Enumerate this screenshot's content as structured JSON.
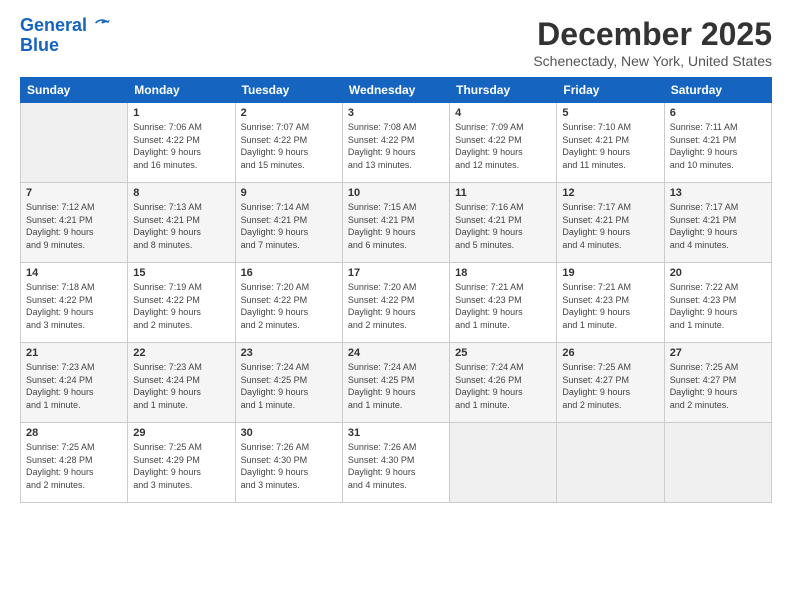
{
  "logo": {
    "line1": "General",
    "line2": "Blue"
  },
  "title": "December 2025",
  "location": "Schenectady, New York, United States",
  "days_header": [
    "Sunday",
    "Monday",
    "Tuesday",
    "Wednesday",
    "Thursday",
    "Friday",
    "Saturday"
  ],
  "weeks": [
    [
      {
        "day": "",
        "info": ""
      },
      {
        "day": "1",
        "info": "Sunrise: 7:06 AM\nSunset: 4:22 PM\nDaylight: 9 hours\nand 16 minutes."
      },
      {
        "day": "2",
        "info": "Sunrise: 7:07 AM\nSunset: 4:22 PM\nDaylight: 9 hours\nand 15 minutes."
      },
      {
        "day": "3",
        "info": "Sunrise: 7:08 AM\nSunset: 4:22 PM\nDaylight: 9 hours\nand 13 minutes."
      },
      {
        "day": "4",
        "info": "Sunrise: 7:09 AM\nSunset: 4:22 PM\nDaylight: 9 hours\nand 12 minutes."
      },
      {
        "day": "5",
        "info": "Sunrise: 7:10 AM\nSunset: 4:21 PM\nDaylight: 9 hours\nand 11 minutes."
      },
      {
        "day": "6",
        "info": "Sunrise: 7:11 AM\nSunset: 4:21 PM\nDaylight: 9 hours\nand 10 minutes."
      }
    ],
    [
      {
        "day": "7",
        "info": "Sunrise: 7:12 AM\nSunset: 4:21 PM\nDaylight: 9 hours\nand 9 minutes."
      },
      {
        "day": "8",
        "info": "Sunrise: 7:13 AM\nSunset: 4:21 PM\nDaylight: 9 hours\nand 8 minutes."
      },
      {
        "day": "9",
        "info": "Sunrise: 7:14 AM\nSunset: 4:21 PM\nDaylight: 9 hours\nand 7 minutes."
      },
      {
        "day": "10",
        "info": "Sunrise: 7:15 AM\nSunset: 4:21 PM\nDaylight: 9 hours\nand 6 minutes."
      },
      {
        "day": "11",
        "info": "Sunrise: 7:16 AM\nSunset: 4:21 PM\nDaylight: 9 hours\nand 5 minutes."
      },
      {
        "day": "12",
        "info": "Sunrise: 7:17 AM\nSunset: 4:21 PM\nDaylight: 9 hours\nand 4 minutes."
      },
      {
        "day": "13",
        "info": "Sunrise: 7:17 AM\nSunset: 4:21 PM\nDaylight: 9 hours\nand 4 minutes."
      }
    ],
    [
      {
        "day": "14",
        "info": "Sunrise: 7:18 AM\nSunset: 4:22 PM\nDaylight: 9 hours\nand 3 minutes."
      },
      {
        "day": "15",
        "info": "Sunrise: 7:19 AM\nSunset: 4:22 PM\nDaylight: 9 hours\nand 2 minutes."
      },
      {
        "day": "16",
        "info": "Sunrise: 7:20 AM\nSunset: 4:22 PM\nDaylight: 9 hours\nand 2 minutes."
      },
      {
        "day": "17",
        "info": "Sunrise: 7:20 AM\nSunset: 4:22 PM\nDaylight: 9 hours\nand 2 minutes."
      },
      {
        "day": "18",
        "info": "Sunrise: 7:21 AM\nSunset: 4:23 PM\nDaylight: 9 hours\nand 1 minute."
      },
      {
        "day": "19",
        "info": "Sunrise: 7:21 AM\nSunset: 4:23 PM\nDaylight: 9 hours\nand 1 minute."
      },
      {
        "day": "20",
        "info": "Sunrise: 7:22 AM\nSunset: 4:23 PM\nDaylight: 9 hours\nand 1 minute."
      }
    ],
    [
      {
        "day": "21",
        "info": "Sunrise: 7:23 AM\nSunset: 4:24 PM\nDaylight: 9 hours\nand 1 minute."
      },
      {
        "day": "22",
        "info": "Sunrise: 7:23 AM\nSunset: 4:24 PM\nDaylight: 9 hours\nand 1 minute."
      },
      {
        "day": "23",
        "info": "Sunrise: 7:24 AM\nSunset: 4:25 PM\nDaylight: 9 hours\nand 1 minute."
      },
      {
        "day": "24",
        "info": "Sunrise: 7:24 AM\nSunset: 4:25 PM\nDaylight: 9 hours\nand 1 minute."
      },
      {
        "day": "25",
        "info": "Sunrise: 7:24 AM\nSunset: 4:26 PM\nDaylight: 9 hours\nand 1 minute."
      },
      {
        "day": "26",
        "info": "Sunrise: 7:25 AM\nSunset: 4:27 PM\nDaylight: 9 hours\nand 2 minutes."
      },
      {
        "day": "27",
        "info": "Sunrise: 7:25 AM\nSunset: 4:27 PM\nDaylight: 9 hours\nand 2 minutes."
      }
    ],
    [
      {
        "day": "28",
        "info": "Sunrise: 7:25 AM\nSunset: 4:28 PM\nDaylight: 9 hours\nand 2 minutes."
      },
      {
        "day": "29",
        "info": "Sunrise: 7:25 AM\nSunset: 4:29 PM\nDaylight: 9 hours\nand 3 minutes."
      },
      {
        "day": "30",
        "info": "Sunrise: 7:26 AM\nSunset: 4:30 PM\nDaylight: 9 hours\nand 3 minutes."
      },
      {
        "day": "31",
        "info": "Sunrise: 7:26 AM\nSunset: 4:30 PM\nDaylight: 9 hours\nand 4 minutes."
      },
      {
        "day": "",
        "info": ""
      },
      {
        "day": "",
        "info": ""
      },
      {
        "day": "",
        "info": ""
      }
    ]
  ]
}
